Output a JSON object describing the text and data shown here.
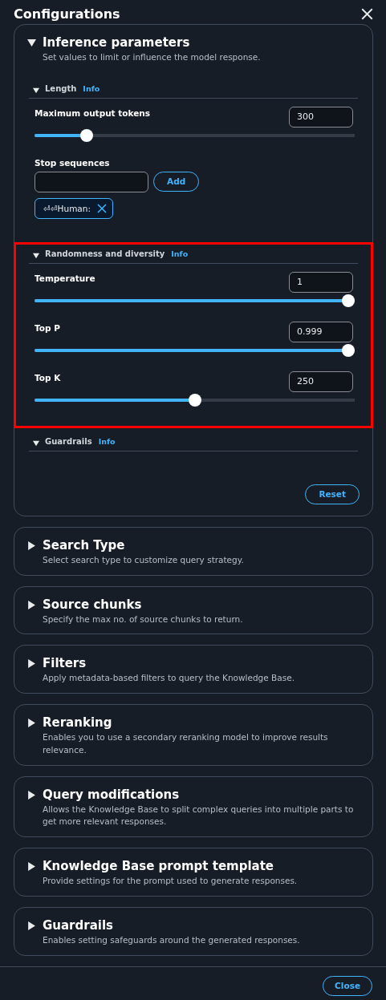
{
  "window": {
    "title": "Configurations"
  },
  "sections": [
    {
      "title": "Inference parameters",
      "description": "Set values to limit or influence the model response.",
      "expanded": true,
      "groups": [
        {
          "title": "Length",
          "info": "Info",
          "expanded": true,
          "highlighted": false,
          "fields": [
            {
              "kind": "slider",
              "label": "Maximum output tokens",
              "value": "300",
              "level": 0.15
            },
            {
              "kind": "stop_sequences",
              "label": "Stop sequences",
              "add": "Add",
              "tokens": [
                {
                  "label": "⏎⏎Human:"
                }
              ]
            }
          ]
        },
        {
          "title": "Randomness and diversity",
          "info": "Info",
          "expanded": true,
          "highlighted": true,
          "fields": [
            {
              "kind": "slider",
              "label": "Temperature",
              "value": "1",
              "level": 1
            },
            {
              "kind": "slider",
              "label": "Top P",
              "value": "0.999",
              "level": 1
            },
            {
              "kind": "slider",
              "label": "Top K",
              "value": "250",
              "level": 0.5
            }
          ]
        },
        {
          "title": "Guardrails",
          "info": "Info",
          "expanded": true,
          "highlighted": false
        }
      ],
      "reset": "Reset"
    },
    {
      "title": "Search Type",
      "description": "Select search type to customize query strategy.",
      "expanded": false
    },
    {
      "title": "Source chunks",
      "description": "Specify the max no. of source chunks to return.",
      "expanded": false
    },
    {
      "title": "Filters",
      "description": "Apply metadata-based filters to query the Knowledge Base.",
      "expanded": false
    },
    {
      "title": "Reranking",
      "description": "Enables you to use a secondary reranking model to improve results relevance.",
      "expanded": false
    },
    {
      "title": "Query modifications",
      "description": "Allows the Knowledge Base to split complex queries into multiple parts to get more relevant responses.",
      "expanded": false
    },
    {
      "title": "Knowledge Base prompt template",
      "description": "Provide settings for the prompt used to generate responses.",
      "expanded": false
    },
    {
      "title": "Guardrails",
      "description": "Enables setting safeguards around the generated responses.",
      "expanded": false
    }
  ],
  "footer": {
    "close": "Close"
  }
}
